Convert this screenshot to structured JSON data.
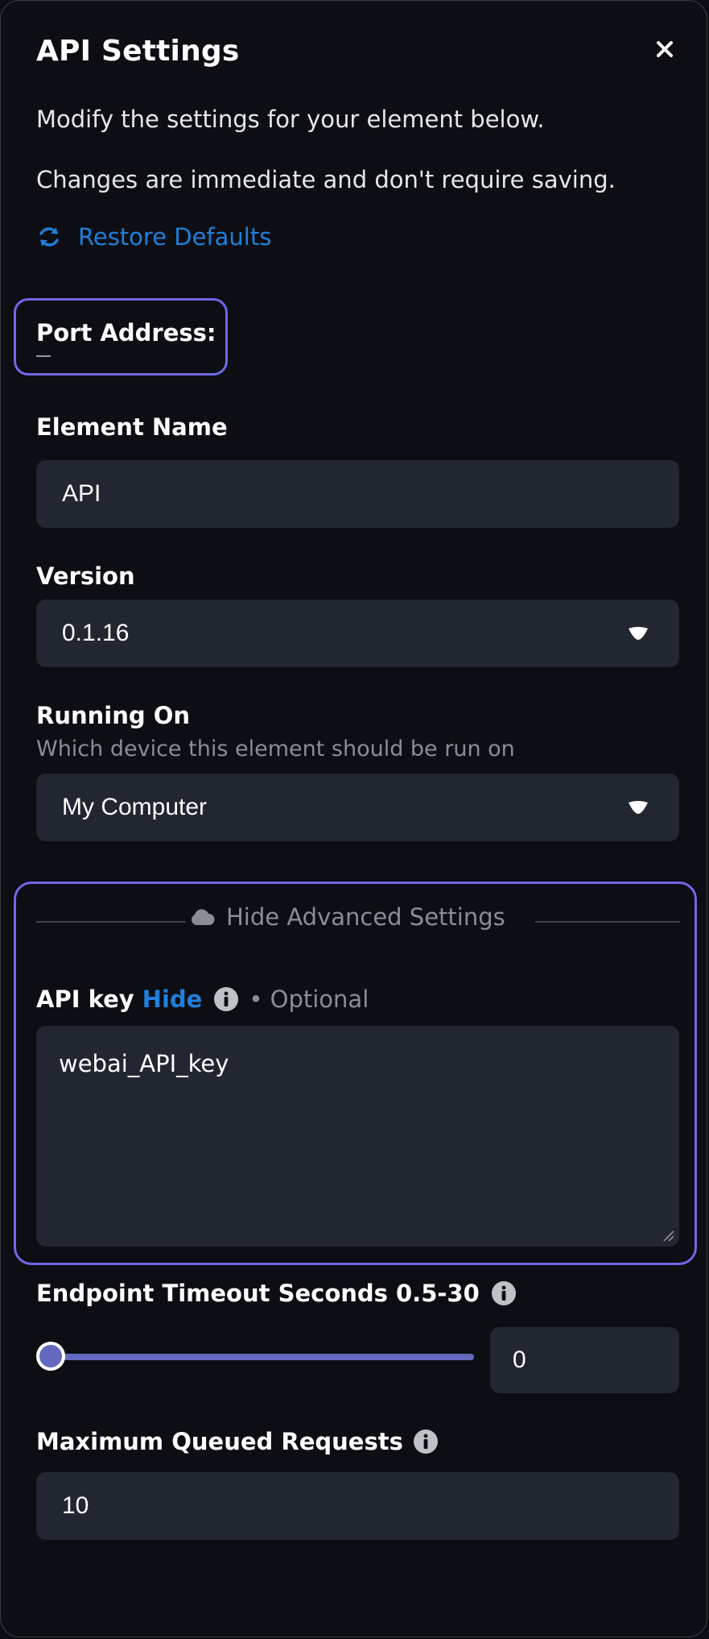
{
  "header": {
    "title": "API Settings",
    "close_icon": "close-icon"
  },
  "intro": {
    "line1": "Modify the settings for your element below.",
    "line2": "Changes are immediate and don't require saving.",
    "restore_label": "Restore Defaults"
  },
  "port": {
    "label": "Port Address:",
    "value": "—"
  },
  "element_name": {
    "label": "Element Name",
    "value": "API"
  },
  "version": {
    "label": "Version",
    "value": "0.1.16"
  },
  "running_on": {
    "label": "Running On",
    "help": "Which device this element should be run on",
    "value": "My Computer"
  },
  "advanced": {
    "toggle_label": "Hide Advanced Settings",
    "api_key": {
      "label": "API key",
      "hide_label": "Hide",
      "optional_label": "• Optional",
      "value": "webai_API_key"
    }
  },
  "timeout": {
    "label": "Endpoint Timeout Seconds 0.5-30",
    "value": "0",
    "slider_level": 0
  },
  "queue": {
    "label": "Maximum Queued Requests",
    "value": "10"
  },
  "colors": {
    "accent": "#1f7fdb",
    "highlight_border": "#6f68e8",
    "slider": "#6369bf",
    "field_bg": "#212630",
    "panel_bg": "#0c0e13"
  }
}
